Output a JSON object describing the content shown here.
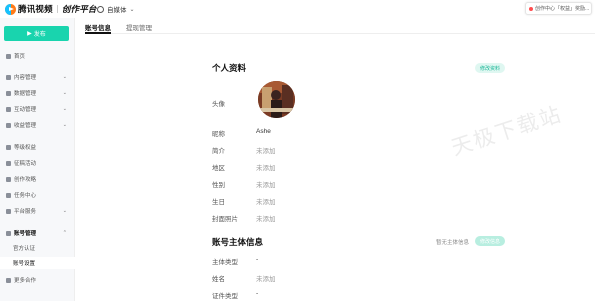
{
  "header": {
    "brand": "腾讯视频",
    "brand_sub": "创作平台",
    "account_type": "自媒体",
    "notice": "创作中心「权益」奖励..."
  },
  "sidebar": {
    "publish_label": "发布",
    "items": [
      {
        "label": "首页"
      },
      {
        "label": "内容管理"
      },
      {
        "label": "数据管理"
      },
      {
        "label": "互动管理"
      },
      {
        "label": "收益管理"
      },
      {
        "label": "等级权益"
      },
      {
        "label": "征稿活动"
      },
      {
        "label": "创作攻略"
      },
      {
        "label": "任务中心"
      },
      {
        "label": "平台服务"
      },
      {
        "label": "账号管理"
      },
      {
        "label": "官方认证"
      },
      {
        "label": "账号设置"
      },
      {
        "label": "更多合作"
      }
    ]
  },
  "tabs": [
    {
      "label": "账号信息"
    },
    {
      "label": "提现管理"
    }
  ],
  "profile": {
    "title": "个人资料",
    "edit_label": "修改资料",
    "fields": [
      {
        "label": "头像",
        "value": ""
      },
      {
        "label": "昵称",
        "value": "Ashe"
      },
      {
        "label": "简介",
        "value": "未添加"
      },
      {
        "label": "地区",
        "value": "未添加"
      },
      {
        "label": "性别",
        "value": "未添加"
      },
      {
        "label": "生日",
        "value": "未添加"
      },
      {
        "label": "封面照片",
        "value": "未添加"
      }
    ]
  },
  "entity": {
    "title": "账号主体信息",
    "hint": "暂无主体信息",
    "button_label": "修改信息",
    "fields": [
      {
        "label": "主体类型",
        "value": "-"
      },
      {
        "label": "姓名",
        "value": "未添加"
      },
      {
        "label": "证件类型",
        "value": "-"
      }
    ]
  },
  "watermark": "天极下载站",
  "colors": {
    "accent": "#19d4ae",
    "sidebar_bg": "#f7f8fa"
  }
}
